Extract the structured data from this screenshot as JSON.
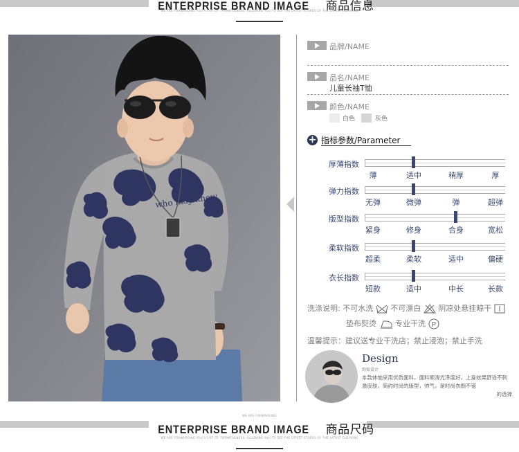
{
  "header": {
    "title_en": "ENTERPRISE BRAND IMAGE",
    "title_zh": "商品信息",
    "small_text": "WE ARE FORWARDING YOU A LIST OF THANKFULNESS, ALLOWING YOU TO SEE THE LATEST STORES OF THE LATEST CLOTHING"
  },
  "footer": {
    "title_en": "ENTERPRISE BRAND IMAGE",
    "title_zh": "商品尺码",
    "small_text_1": "WE ARE FORWARDING",
    "small_text_2": "WE ARE FORWARDING YOU A LIST OF THANKFULNESS, ALLOWING YOU TO SEE THE LATEST STORES OF THE LATEST CLOTHING"
  },
  "photo": {
    "shirt_print": "who may know",
    "shirt_color": "#a9a9a9",
    "print_color": "#2e3560",
    "jeans_color": "#5778a3",
    "hair_color": "#141414"
  },
  "info": {
    "brand_label": "品牌/NAME",
    "product_label": "品名/NAME",
    "product_value": "儿童长袖T恤",
    "color_label": "颜色/NAME",
    "colors": [
      "白色",
      "灰色"
    ]
  },
  "parameter": {
    "title": "指标参数/Parameter",
    "rows": [
      {
        "name": "厚薄指数",
        "options": [
          "薄",
          "适中",
          "稍厚",
          "厚"
        ],
        "selected": 1
      },
      {
        "name": "弹力指数",
        "options": [
          "无弹",
          "微弹",
          "弹",
          "超弹"
        ],
        "selected": 1
      },
      {
        "name": "版型指数",
        "options": [
          "紧身",
          "修身",
          "合身",
          "宽松"
        ],
        "selected": 2
      },
      {
        "name": "柔软指数",
        "options": [
          "超柔",
          "柔软",
          "适中",
          "偏硬"
        ],
        "selected": 1
      },
      {
        "name": "衣长指数",
        "options": [
          "短款",
          "适中",
          "中长",
          "长款"
        ],
        "selected": 1
      }
    ]
  },
  "care": {
    "label": "洗涤说明:",
    "item1": "不可水洗",
    "item2": "不可漂白",
    "item3": "阴凉处悬挂晾干",
    "item4": "垫布熨烫",
    "item5": "专业干洗",
    "tip": "温馨提示：建议送专业干洗店；禁止浸泡；禁止手洗"
  },
  "design": {
    "title": "Design",
    "subtitle": "韵知设计",
    "text_main": "本款体恤采用优质面料，面料顺滑光泽度好，上身效果舒适不刺激皮肤，简约时尚的版型，帅气，是时尚衣橱不错",
    "text_last": "的选择"
  }
}
